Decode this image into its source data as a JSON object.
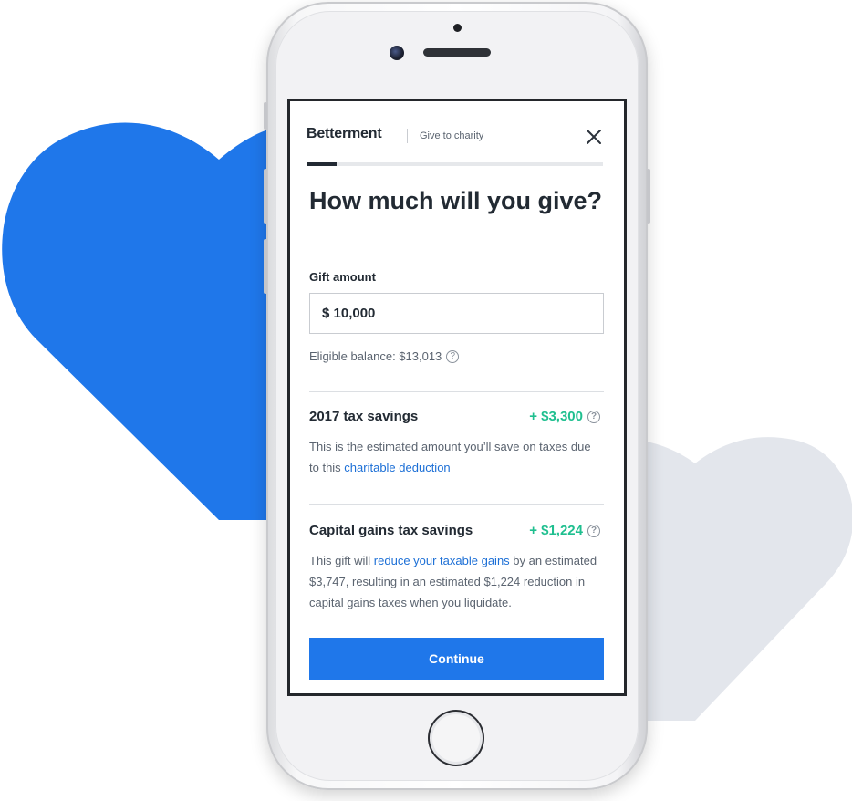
{
  "colors": {
    "brand_blue": "#1f77ea",
    "heart_left": "#1f77ea",
    "heart_right": "#e3e6ec",
    "positive_green": "#1fbf8f",
    "text_dark": "#222a33",
    "link_blue": "#1c6fd6"
  },
  "header": {
    "brand": "Betterment",
    "context": "Give to charity",
    "close_icon": "close-icon",
    "progress_fraction": 0.1
  },
  "form": {
    "title": "How much will you give?",
    "gift_label": "Gift amount",
    "gift_value": "$ 10,000",
    "eligible_balance": "Eligible balance: $13,013",
    "help_icon": "question-circle-icon"
  },
  "tax_savings": {
    "title": "2017 tax savings",
    "value": "+ $3,300",
    "body_prefix": "This is the estimated amount you’ll save on taxes due to this ",
    "body_link": "charitable deduction"
  },
  "cap_gains": {
    "title": "Capital gains tax savings",
    "value": "+ $1,224",
    "body_prefix": "This gift will ",
    "body_link": "reduce your taxable gains",
    "body_suffix": " by an estimated $3,747, resulting in an estimated $1,224 reduction in capital gains taxes when you liquidate."
  },
  "continue_label": "Continue"
}
